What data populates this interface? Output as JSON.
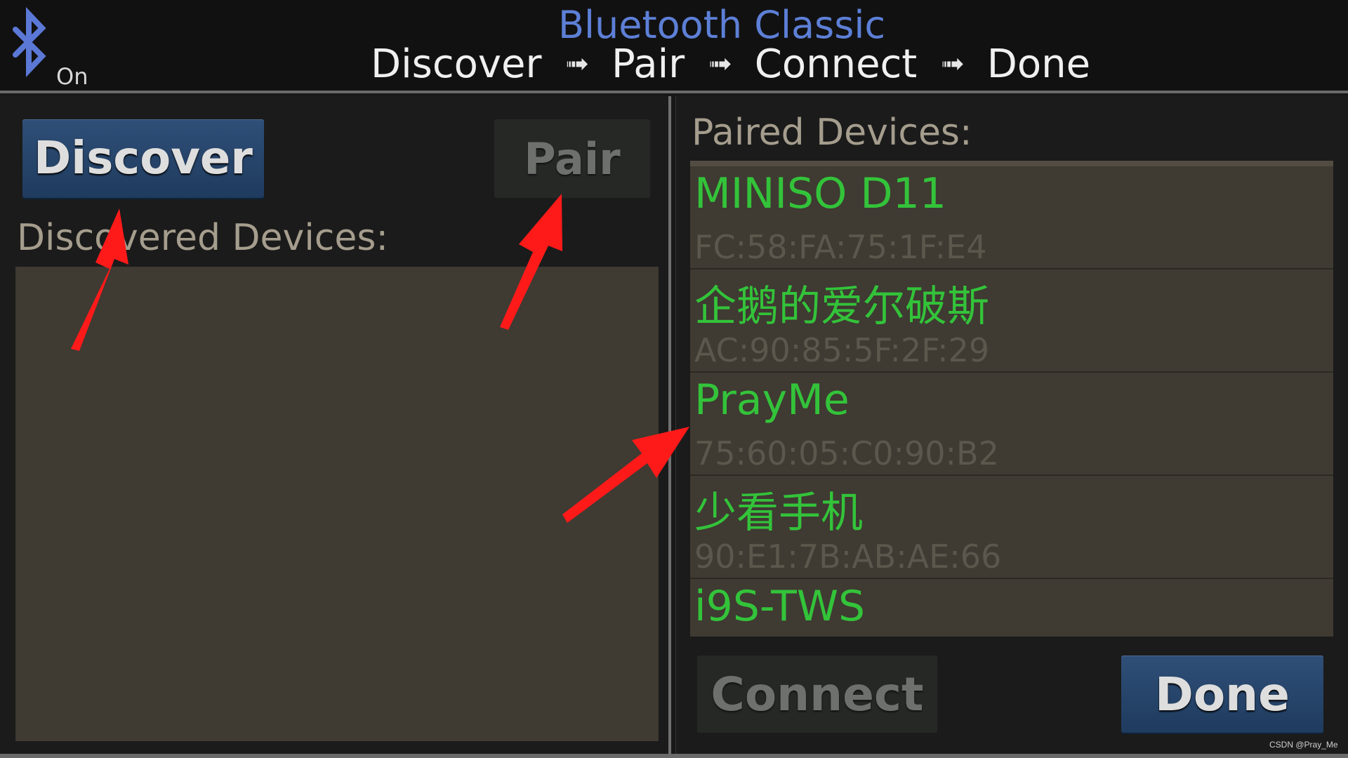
{
  "header": {
    "app_title": "Bluetooth Classic",
    "bluetooth_status": "On",
    "steps": [
      "Discover",
      "Pair",
      "Connect",
      "Done"
    ],
    "step_arrow": "➟"
  },
  "left_panel": {
    "discover_label": "Discover",
    "pair_label": "Pair",
    "discovered_header": "Discovered Devices:",
    "discovered_devices": []
  },
  "right_panel": {
    "paired_header": "Paired Devices:",
    "paired_devices": [
      {
        "name": "MINISO D11",
        "address": "FC:58:FA:75:1F:E4"
      },
      {
        "name": "企鹅的爱尔破斯",
        "address": "AC:90:85:5F:2F:29"
      },
      {
        "name": "PrayMe",
        "address": "75:60:05:C0:90:B2"
      },
      {
        "name": "少看手机",
        "address": "90:E1:7B:AB:AE:66"
      },
      {
        "name": "i9S-TWS",
        "address": ""
      }
    ],
    "connect_label": "Connect",
    "done_label": "Done"
  },
  "watermark": "CSDN @Pray_Me",
  "colors": {
    "accent_blue": "#5d7fd6",
    "device_name_green": "#33c33a",
    "annotation_red": "#ff1a1a",
    "button_active": "#2f4f78"
  }
}
